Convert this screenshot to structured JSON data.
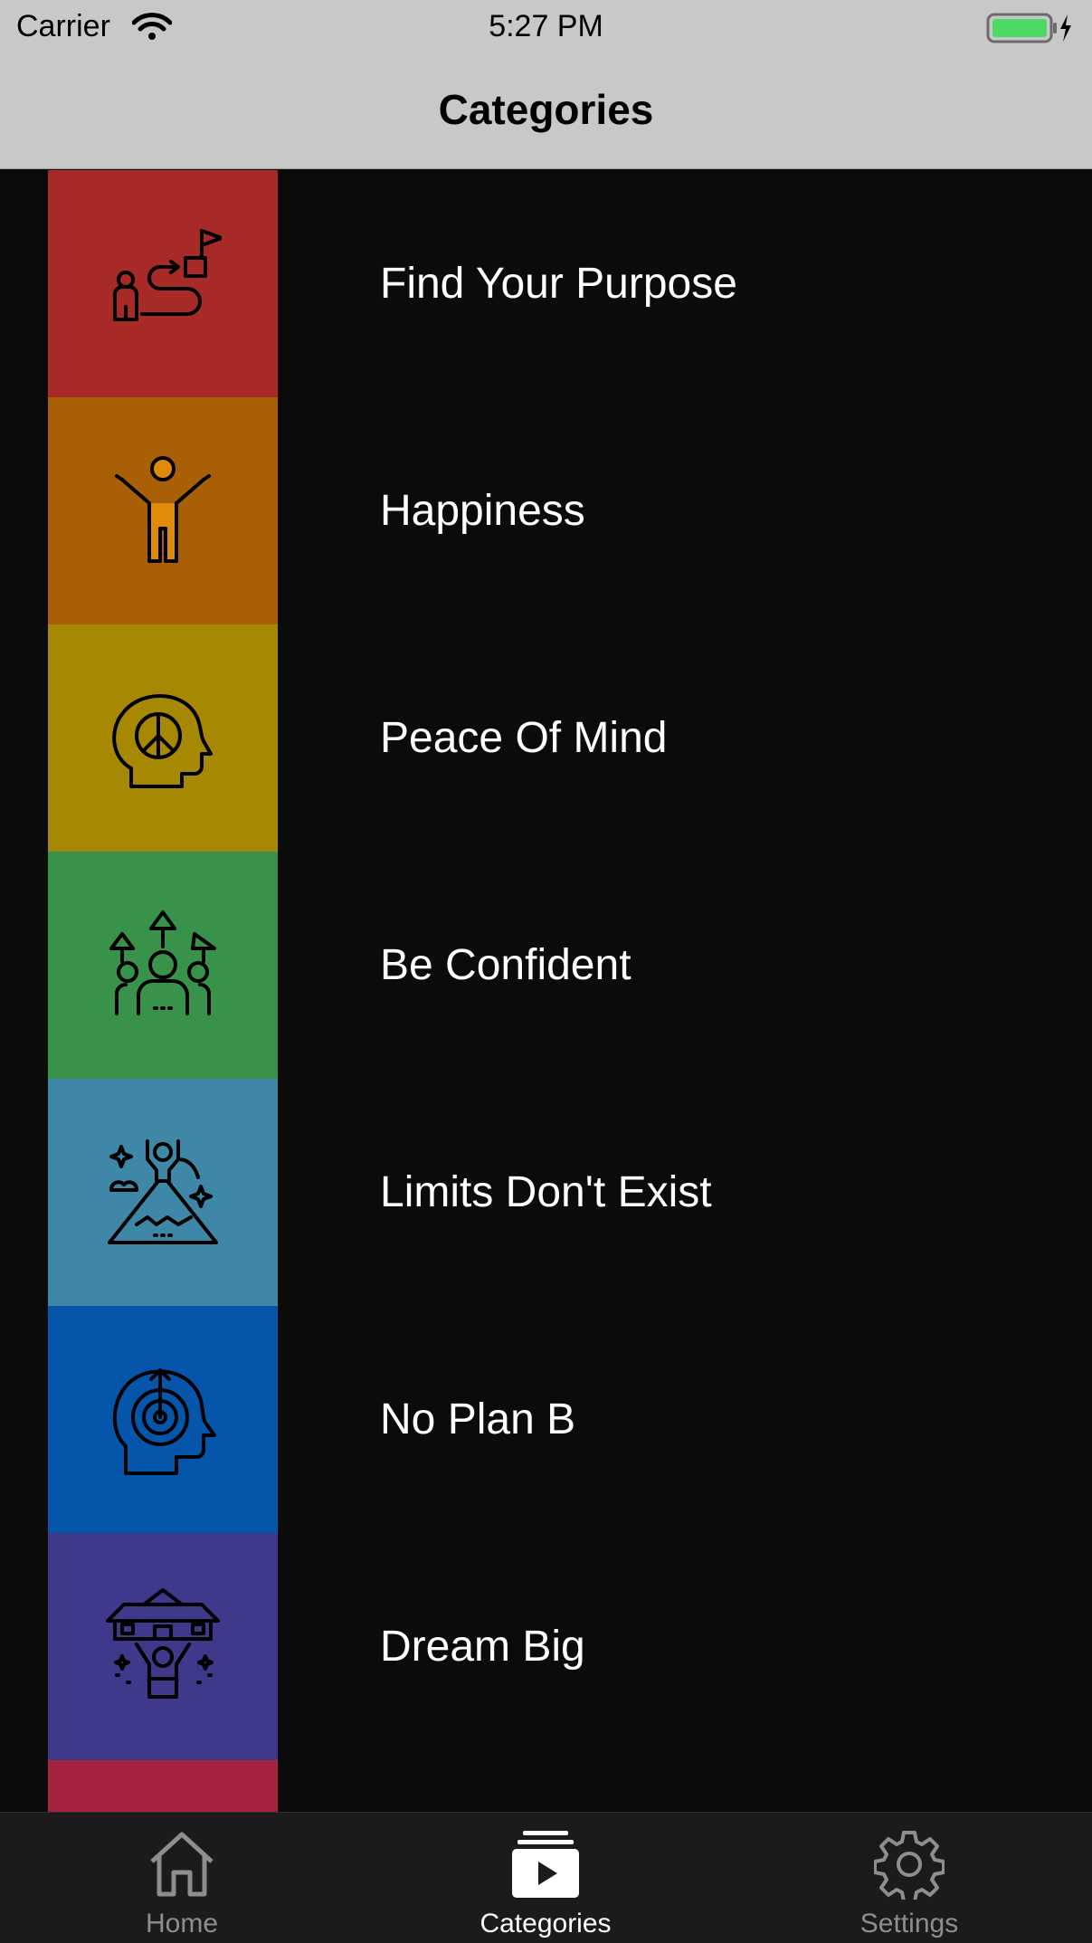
{
  "status_bar": {
    "carrier": "Carrier",
    "time": "5:27 PM"
  },
  "nav": {
    "title": "Categories"
  },
  "categories": [
    {
      "label": "Find Your Purpose",
      "color": "#a72a26",
      "icon": "purpose-path-icon"
    },
    {
      "label": "Happiness",
      "color": "#a85f05",
      "icon": "happy-person-icon"
    },
    {
      "label": "Peace Of Mind",
      "color": "#a78803",
      "icon": "peace-head-icon"
    },
    {
      "label": "Be Confident",
      "color": "#38924a",
      "icon": "confident-group-icon"
    },
    {
      "label": "Limits Don't Exist",
      "color": "#3f87a6",
      "icon": "mountain-summit-icon"
    },
    {
      "label": "No Plan B",
      "color": "#0555ab",
      "icon": "target-head-icon"
    },
    {
      "label": "Dream Big",
      "color": "#3e398a",
      "icon": "dream-house-icon"
    },
    {
      "label": "",
      "color": "#a6233f",
      "icon": ""
    }
  ],
  "tabs": [
    {
      "label": "Home",
      "icon": "home-icon",
      "active": false
    },
    {
      "label": "Categories",
      "icon": "categories-icon",
      "active": true
    },
    {
      "label": "Settings",
      "icon": "gear-icon",
      "active": false
    }
  ]
}
